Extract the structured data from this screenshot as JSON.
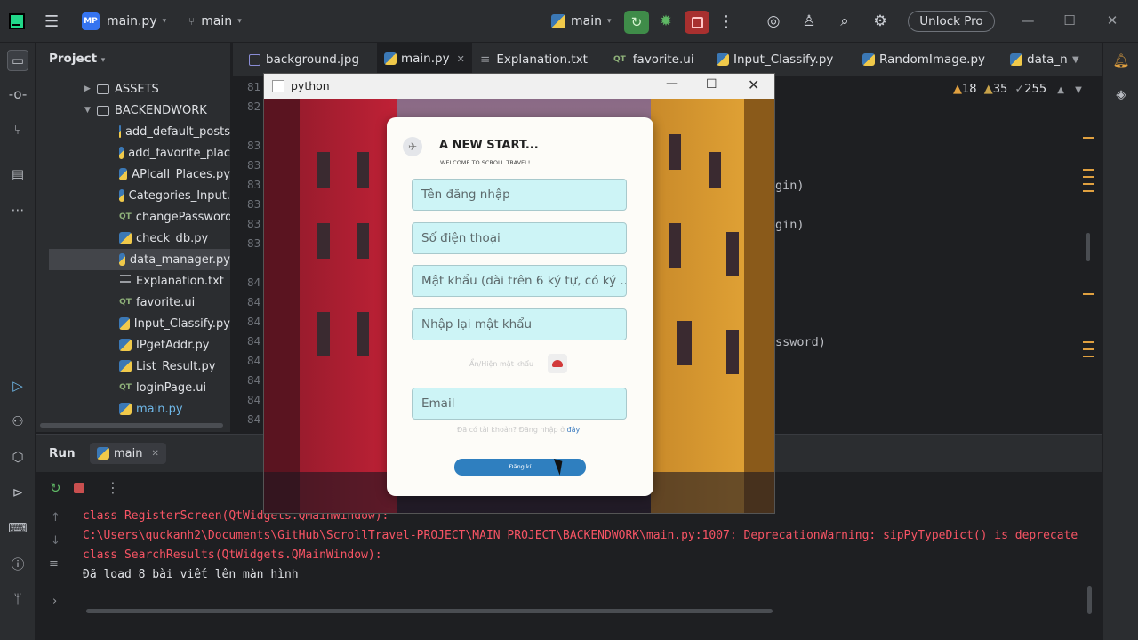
{
  "ide": {
    "project_badge": "MP",
    "project_name": "main.py",
    "branch": "main",
    "run_config": "main",
    "unlock_label": "Unlock Pro"
  },
  "project_panel": {
    "title": "Project",
    "items": [
      {
        "label": "ASSETS"
      },
      {
        "label": "BACKENDWORK"
      },
      {
        "label": "add_default_posts"
      },
      {
        "label": "add_favorite_plac"
      },
      {
        "label": "APIcall_Places.py"
      },
      {
        "label": "Categories_Input."
      },
      {
        "label": "changePassword'"
      },
      {
        "label": "check_db.py"
      },
      {
        "label": "data_manager.py"
      },
      {
        "label": "Explanation.txt"
      },
      {
        "label": "favorite.ui"
      },
      {
        "label": "Input_Classify.py"
      },
      {
        "label": "IPgetAddr.py"
      },
      {
        "label": "List_Result.py"
      },
      {
        "label": "loginPage.ui"
      },
      {
        "label": "main.py"
      }
    ]
  },
  "editor": {
    "tabs": [
      {
        "label": "background.jpg"
      },
      {
        "label": "main.py"
      },
      {
        "label": "Explanation.txt"
      },
      {
        "label": "favorite.ui"
      },
      {
        "label": "Input_Classify.py"
      },
      {
        "label": "RandomImage.py"
      },
      {
        "label": "data_n"
      }
    ],
    "line_numbers": [
      "81",
      "82",
      "83",
      "83",
      "83",
      "83",
      "83",
      "83",
      "84",
      "84",
      "84",
      "84",
      "84",
      "84",
      "84",
      "84"
    ],
    "code_fragments": [
      "gin)",
      "gin)",
      "ssword)"
    ],
    "inspections": {
      "warnings": "18",
      "weak": "35",
      "checks": "255"
    }
  },
  "run": {
    "title": "Run",
    "tab_label": "main",
    "console": [
      {
        "text": "  class RegisterScreen(QtWidgets.QMainWindow):",
        "type": "err"
      },
      {
        "text": "C:\\Users\\quckanh2\\Documents\\GitHub\\ScrollTravel-PROJECT\\MAIN PROJECT\\BACKENDWORK\\main.py:1007: DeprecationWarning: sipPyTypeDict() is deprecate",
        "type": "err"
      },
      {
        "text": "  class SearchResults(QtWidgets.QMainWindow):",
        "type": "err"
      },
      {
        "text": "Đã load 8 bài viết lên màn hình",
        "type": "norm"
      }
    ]
  },
  "app_window": {
    "title": "python",
    "form": {
      "heading": "A NEW START...",
      "subheading": "WELCOME TO SCROLL TRAVEL!",
      "username_placeholder": "Tên đăng nhập",
      "phone_placeholder": "Số điện thoại",
      "password_placeholder": "Mật khẩu (dài trên 6 ký tự, có ký ...",
      "confirm_placeholder": "Nhập lại mật khẩu",
      "toggle_label": "Ẩn/Hiện mật khẩu",
      "email_placeholder": "Email",
      "login_prompt": "Đã có tài khoản? Đăng nhập ở",
      "login_link": "đây",
      "submit_label": "Đăng kí"
    }
  },
  "colors": {
    "accent": "#3574f0",
    "error": "#f75464",
    "field_bg": "#cdf4f6",
    "submit": "#2f7fbf"
  }
}
